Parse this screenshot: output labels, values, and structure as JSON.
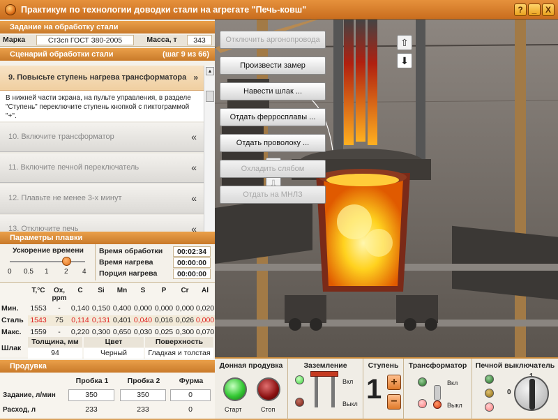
{
  "window": {
    "title": "Практикум по технологии доводки стали на агрегате \"Печь-ковш\"",
    "help_label": "?",
    "minimize_label": "_",
    "close_label": "X"
  },
  "task": {
    "header": "Задание на обработку стали",
    "grade_label": "Марка",
    "grade_value": "Ст3сп ГОСТ 380-2005",
    "mass_label": "Масса, т",
    "mass_value": "343"
  },
  "scenario": {
    "header": "Сценарий обработки стали",
    "step_counter": "(шаг 9 из 66)",
    "active_step": "9.  Повысьте ступень нагрева трансформатора",
    "active_desc": "В нижней части экрана, на пульте управления, в разделе \"Ступень\" переключите ступень кнопкой с пиктограммой \"+\".",
    "collapse_glyph": "»",
    "expand_glyph": "«",
    "steps": [
      "10. Включите трансформатор",
      "11. Включите печной переключатель",
      "12. Плавьте не менее 3-х минут",
      "13. Отключите печь"
    ]
  },
  "melt": {
    "header": "Параметры плавки",
    "accel_label": "Ускорение времени",
    "accel_ticks": [
      "0",
      "0.5",
      "1",
      "2",
      "4"
    ],
    "accel_value": 2,
    "proc_time_label": "Время обработки",
    "proc_time": "00:02:34",
    "heat_time_label": "Время нагрева",
    "heat_time": "00:00:00",
    "batch_time_label": "Порция нагрева",
    "batch_time": "00:00:00"
  },
  "chem": {
    "headers": [
      "T,°C",
      "Ox, ppm",
      "C",
      "Si",
      "Mn",
      "S",
      "P",
      "Cr",
      "Al"
    ],
    "rows": [
      {
        "label": "Мин.",
        "values": [
          "1553",
          "-",
          "0,140",
          "0,150",
          "0,400",
          "0,000",
          "0,000",
          "0,000",
          "0,020"
        ]
      },
      {
        "label": "Сталь",
        "values": [
          "1543",
          "75",
          "0,114",
          "0,131",
          "0,401",
          "0,040",
          "0,016",
          "0,026",
          "0,000"
        ]
      },
      {
        "label": "Макс.",
        "values": [
          "1559",
          "-",
          "0,220",
          "0,300",
          "0,650",
          "0,030",
          "0,025",
          "0,300",
          "0,070"
        ]
      }
    ],
    "slag_label": "Шлак",
    "slag_headers": [
      "Толщина, мм",
      "Цвет",
      "Поверхность"
    ],
    "slag_values": [
      "94",
      "Черный",
      "Гладкая и толстая"
    ]
  },
  "purge": {
    "header": "Продувка",
    "cols": [
      "Пробка 1",
      "Пробка 2",
      "Фурма"
    ],
    "target_label": "Задание, л/мин",
    "targets": [
      "350",
      "350",
      "0"
    ],
    "flow_label": "Расход, л",
    "flows": [
      "233",
      "233",
      "0"
    ]
  },
  "actions": [
    {
      "label": "Отключить аргонопровода",
      "enabled": false
    },
    {
      "label": "Произвести замер",
      "enabled": true
    },
    {
      "label": "Навести шлак ...",
      "enabled": true
    },
    {
      "label": "Отдать ферросплавы ...",
      "enabled": true
    },
    {
      "label": "Отдать проволоку ...",
      "enabled": true
    },
    {
      "label": "Охладить слябом",
      "enabled": false
    },
    {
      "label": "Отдать на МНЛЗ",
      "enabled": false
    }
  ],
  "control": {
    "bottom_purge": {
      "title": "Донная продувка",
      "start": "Старт",
      "stop": "Стоп"
    },
    "ground": {
      "title": "Заземление",
      "on": "Вкл",
      "off": "Выкл"
    },
    "stage": {
      "title": "Ступень",
      "value": "1",
      "plus": "+",
      "minus": "−"
    },
    "transformer": {
      "title": "Трансформатор",
      "on": "Вкл",
      "off": "Выкл"
    },
    "furnace_switch": {
      "title": "Печной выключатель",
      "pos0": "0",
      "pos1": "1"
    }
  },
  "colors": {
    "accent": "#d9893a",
    "header": "#c97a2a",
    "red_value": "#e02020"
  }
}
